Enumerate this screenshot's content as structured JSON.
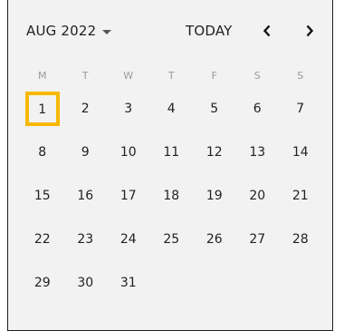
{
  "calendar": {
    "month_label": "AUG 2022",
    "today_label": "TODAY",
    "weekdays": [
      "M",
      "T",
      "W",
      "T",
      "F",
      "S",
      "S"
    ],
    "weeks": [
      [
        "1",
        "2",
        "3",
        "4",
        "5",
        "6",
        "7"
      ],
      [
        "8",
        "9",
        "10",
        "11",
        "12",
        "13",
        "14"
      ],
      [
        "15",
        "16",
        "17",
        "18",
        "19",
        "20",
        "21"
      ],
      [
        "22",
        "23",
        "24",
        "25",
        "26",
        "27",
        "28"
      ],
      [
        "29",
        "30",
        "31",
        "",
        "",
        "",
        ""
      ]
    ],
    "selected_day": "1"
  },
  "icons": {
    "month_dropdown": "caret-down-icon",
    "prev": "chevron-left-icon",
    "next": "chevron-right-icon"
  },
  "colors": {
    "selection_border": "#f6b800",
    "background": "#f2f2f2"
  }
}
